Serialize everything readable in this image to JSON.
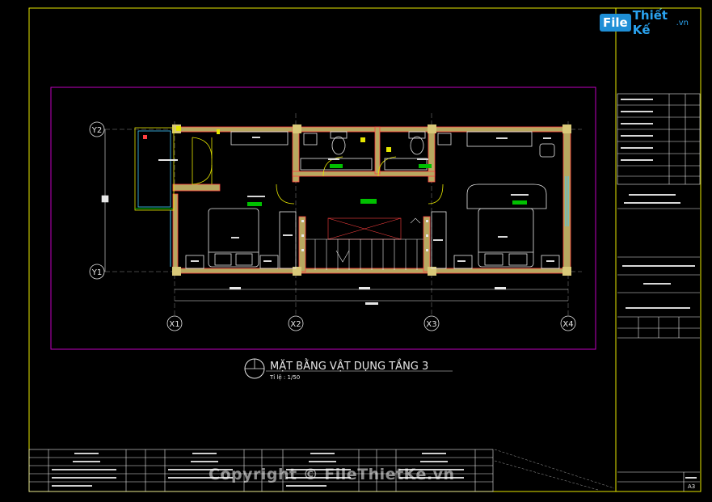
{
  "colors": {
    "frame": "#e6e600",
    "viewport": "#c000c0",
    "wall": "#ff4040",
    "wall_fill": "#d8c878",
    "grid": "#a0a0a0",
    "furniture": "#e8e8e8",
    "tag": "#00c000",
    "door": "#e6e600",
    "glass": "#40c8ff"
  },
  "logo": {
    "brand": "File",
    "rest": "Thiết Kế",
    "tld": ".vn"
  },
  "watermark": "Copyright © FileThietKe.vn",
  "plan": {
    "title": "MẶT BẰNG VẬT DỤNG TẦNG 3",
    "scale": "Tỉ lệ :   1/50",
    "grid_v": [
      "X1",
      "X2",
      "X3",
      "X4"
    ],
    "grid_h": [
      "Y2",
      "Y1"
    ]
  },
  "sheet": {
    "size": "A3"
  }
}
